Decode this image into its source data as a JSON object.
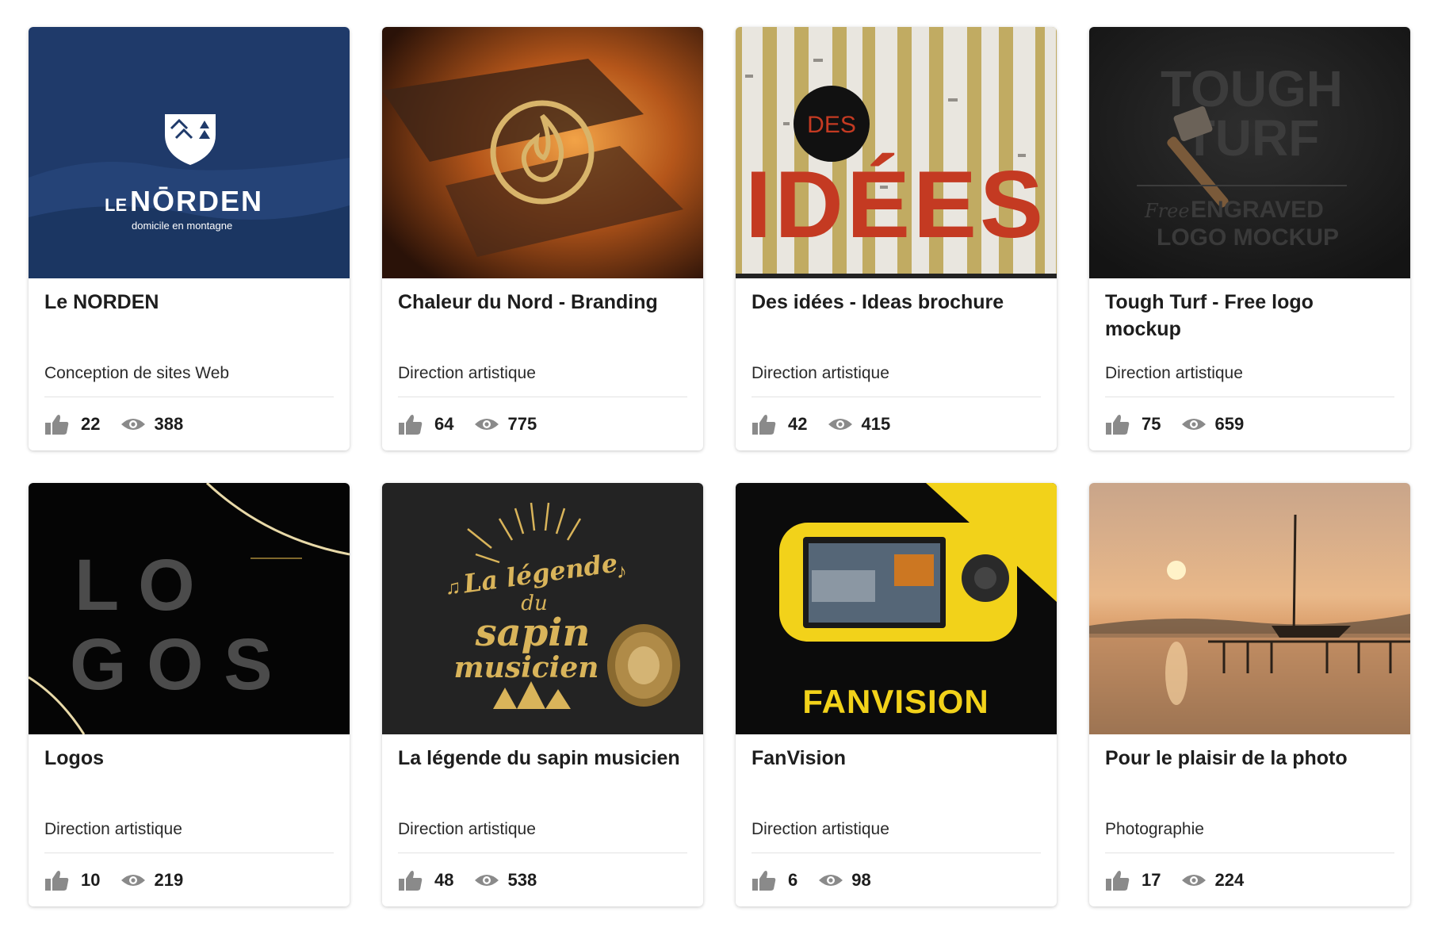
{
  "projects": [
    {
      "title": "Le NORDEN",
      "category": "Conception de sites Web",
      "likes": "22",
      "views": "388",
      "thumb": {
        "brand_top": "LE",
        "brand_name": "NŌRDEN",
        "tagline": "domicile en montagne",
        "bg": "#1f3a6a"
      }
    },
    {
      "title": "Chaleur du Nord - Branding",
      "category": "Direction artistique",
      "likes": "64",
      "views": "775",
      "thumb": {
        "bg": "#5a2a10",
        "accent": "#d8b46a"
      }
    },
    {
      "title": "Des idées - Ideas brochure",
      "category": "Direction artistique",
      "likes": "42",
      "views": "415",
      "thumb": {
        "badge": "DES",
        "word": "IDÉES",
        "accent": "#c43a22"
      }
    },
    {
      "title": "Tough Turf - Free logo mockup",
      "category": "Direction artistique",
      "likes": "75",
      "views": "659",
      "thumb": {
        "line1": "TOUGH",
        "line2": "TURF",
        "free": "Free",
        "line3": "ENGRAVED",
        "line4": "LOGO MOCKUP"
      }
    },
    {
      "title": "Logos",
      "category": "Direction artistique",
      "likes": "10",
      "views": "219",
      "thumb": {
        "line1": "L O",
        "line2": "G O S"
      }
    },
    {
      "title": "La légende du sapin musicien",
      "category": "Direction artistique",
      "likes": "48",
      "views": "538",
      "thumb": {
        "line1": "La légende",
        "line2": "du",
        "line3": "sapin",
        "line4": "musicien",
        "accent": "#d9b45a"
      }
    },
    {
      "title": "FanVision",
      "category": "Direction artistique",
      "likes": "6",
      "views": "98",
      "thumb": {
        "brand": "FANVISION",
        "accent": "#f2d21a"
      }
    },
    {
      "title": "Pour le plaisir de la photo",
      "category": "Photographie",
      "likes": "17",
      "views": "224",
      "thumb": {
        "sky": "#e9b889"
      }
    }
  ],
  "icons": {
    "like": "thumbs-up-icon",
    "views": "eye-icon"
  },
  "colors": {
    "icon": "#8a8a8a",
    "text": "#1d1d1d"
  }
}
